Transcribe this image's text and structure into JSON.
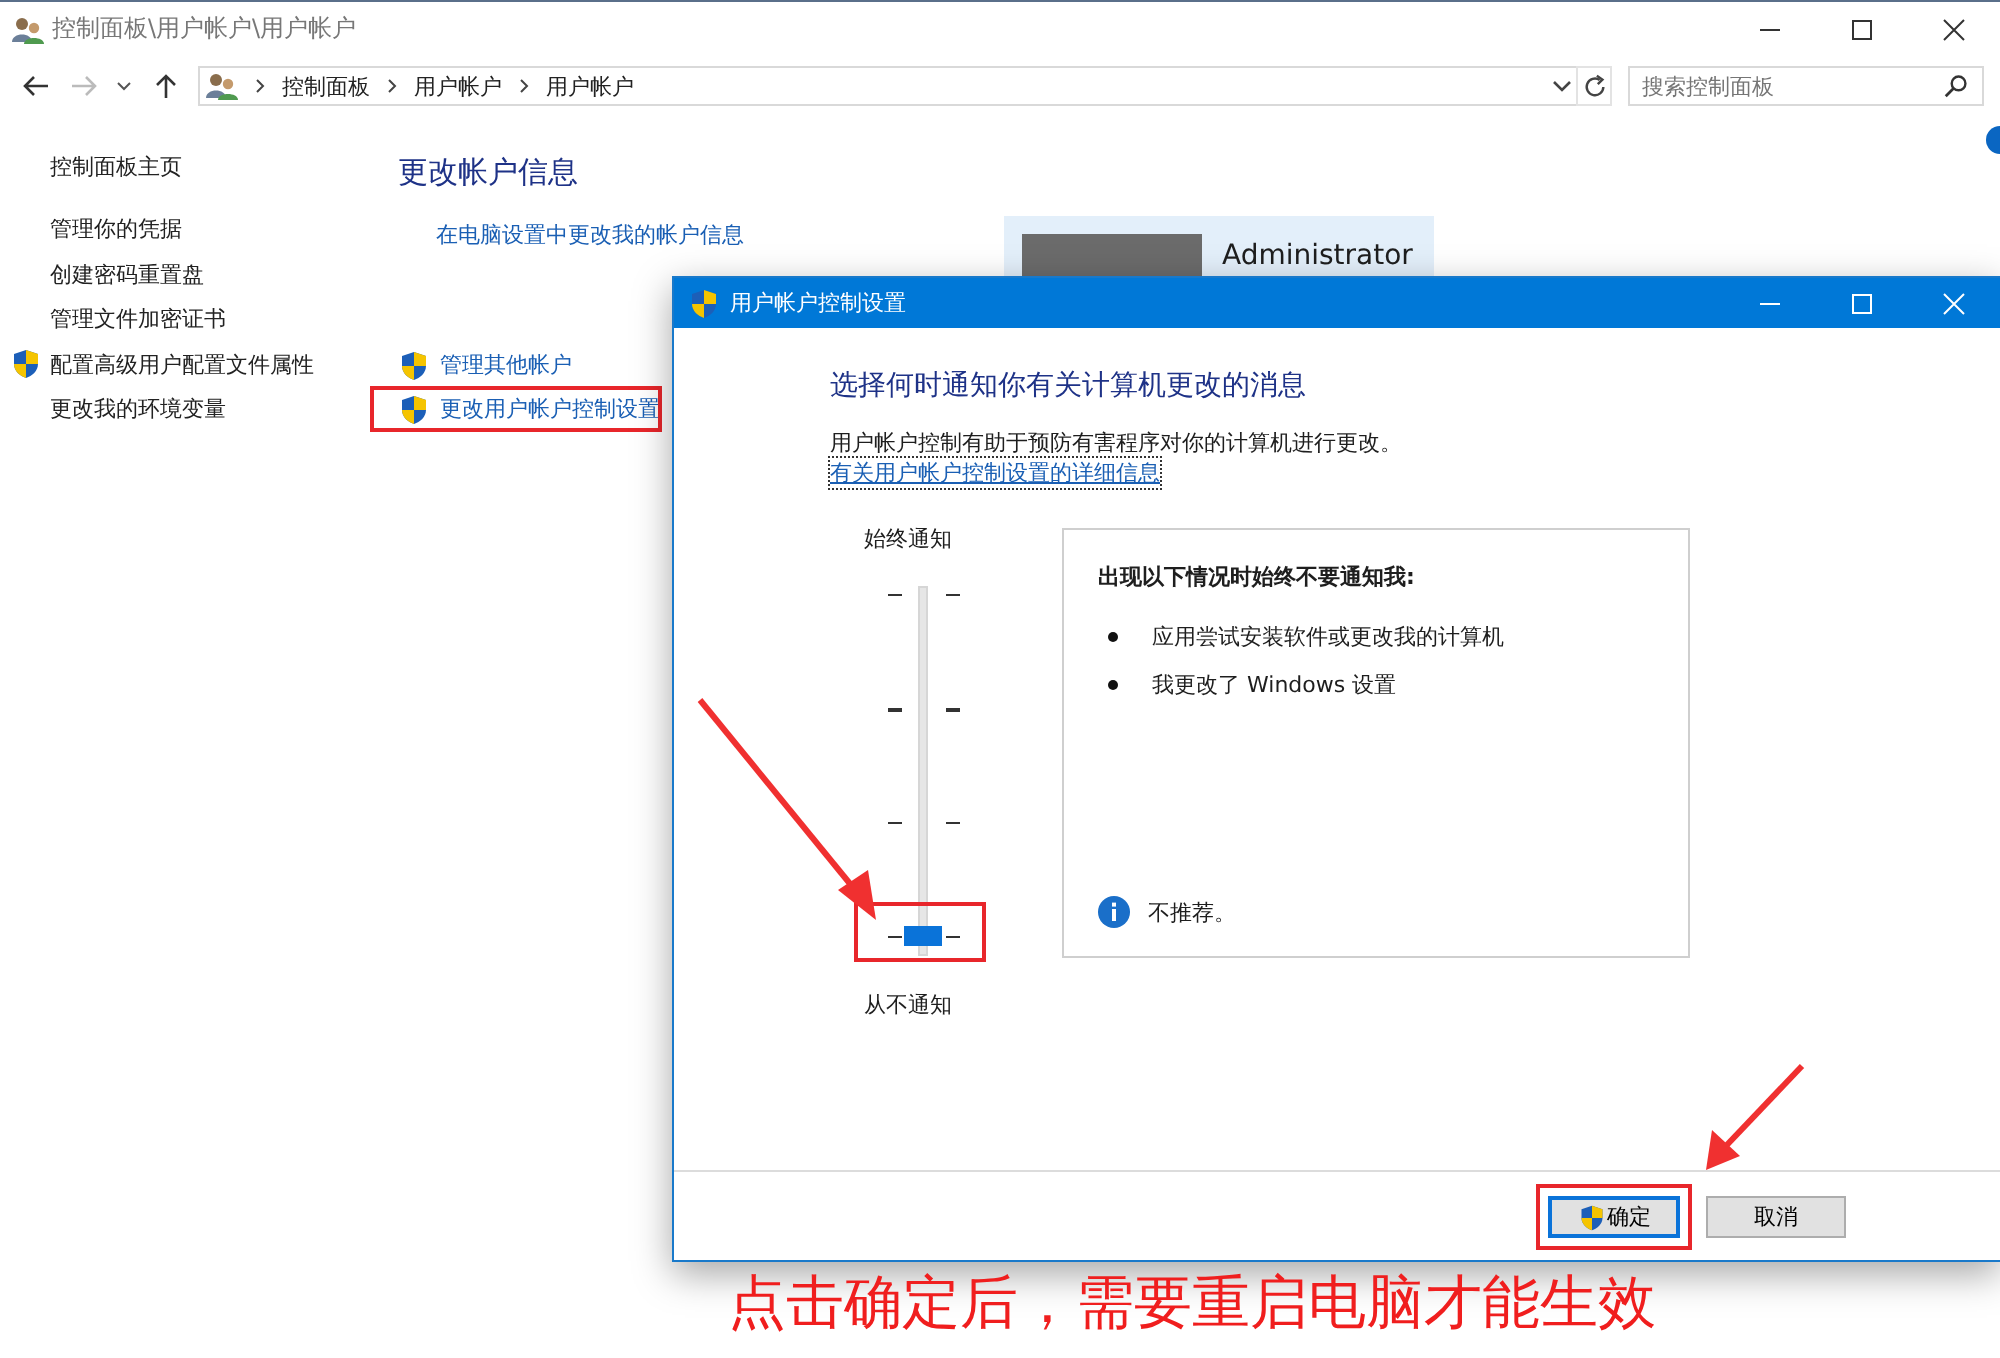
{
  "window": {
    "title": "控制面板\\用户帐户\\用户帐户"
  },
  "breadcrumb": [
    "控制面板",
    "用户帐户",
    "用户帐户"
  ],
  "search": {
    "placeholder": "搜索控制面板"
  },
  "sidebar": {
    "items": [
      {
        "label": "控制面板主页",
        "kind": "home"
      },
      {
        "label": "管理你的凭据",
        "kind": "link"
      },
      {
        "label": "创建密码重置盘",
        "kind": "link"
      },
      {
        "label": "管理文件加密证书",
        "kind": "link"
      },
      {
        "label": "配置高级用户配置文件属性",
        "kind": "shield"
      },
      {
        "label": "更改我的环境变量",
        "kind": "link"
      }
    ]
  },
  "main": {
    "heading": "更改帐户信息",
    "links": [
      "在电脑设置中更改我的帐户信息"
    ],
    "account": {
      "name": "Administrator"
    },
    "tasks": [
      {
        "label": "管理其他帐户",
        "highlighted": false
      },
      {
        "label": "更改用户帐户控制设置",
        "highlighted": true
      }
    ]
  },
  "dialog": {
    "title": "用户帐户控制设置",
    "heading": "选择何时通知你有关计算机更改的消息",
    "description": "用户帐户控制有助于预防有害程序对你的计算机进行更改。",
    "link": "有关用户帐户控制设置的详细信息",
    "slider": {
      "top_label": "始终通知",
      "bottom_label": "从不通知",
      "level": 0,
      "highlighted": true
    },
    "info": {
      "heading": "出现以下情况时始终不要通知我:",
      "bullets": [
        "应用尝试安装软件或更改我的计算机",
        "我更改了 Windows 设置"
      ],
      "note": "不推荐。"
    },
    "buttons": [
      {
        "label": "确定",
        "kind": "primary",
        "highlighted": true
      },
      {
        "label": "取消",
        "kind": "normal",
        "highlighted": false
      }
    ]
  },
  "annotation": {
    "caption": "点击确定后，需要重启电脑才能生效"
  }
}
